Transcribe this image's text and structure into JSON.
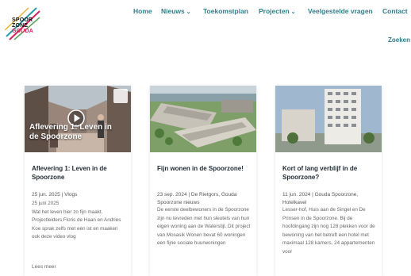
{
  "logo": {
    "line1": "SPOOR",
    "line2": "ZONE",
    "line3": "GOUDA"
  },
  "nav": {
    "items": [
      {
        "label": "Home",
        "dropdown": false
      },
      {
        "label": "Nieuws",
        "dropdown": true
      },
      {
        "label": "Toekomstplan",
        "dropdown": false
      },
      {
        "label": "Projecten",
        "dropdown": true
      },
      {
        "label": "Veelgestelde vragen",
        "dropdown": false
      },
      {
        "label": "Contact",
        "dropdown": false
      }
    ],
    "search_label": "Zoeken",
    "chevron": "⌄"
  },
  "cards": [
    {
      "video_caption": "Aflevering 1: Leven in de Spoorzone",
      "title": "Aflevering 1: Leven in de Spoorzone",
      "meta": "25 jun. 2025 | Vlogs",
      "date_line": "25 juni 2025",
      "excerpt": "Wat het leven hier zo fijn maakt. Projectleiders Floris de Haan en Andries Koe sprak zelfs met een ist en maaken ook deze video vlog",
      "read_more": "Lees meer"
    },
    {
      "title": "Fijn wonen in de Spoorzone!",
      "meta": "23 sep. 2024 | De Rietgors, Gouda Spoorzone nieuws",
      "excerpt": "De eerste deelbewoners in de Spoorzone zijn nu tevreden met hun sleutels van hun eigen woning aan de Waterstijl. Dit project van Mosasik Wonen bevat 60 woningen een fijne sociale huurwoningen",
      "read_more": ""
    },
    {
      "title": "Kort of lang verblijf in de Spoorzone?",
      "meta": "11 jun. 2024 | Gouda Spoorzone, Hotelkavel",
      "excerpt": "Lesser-hof, Huis aan de Singel en De Prinsen in de Spoorzone. Bij de hoofdingang zijn nog 128 plekken voor de bewoning van het betreft een hotel met maximaal 128 kamers, 24 appartementen voor",
      "read_more": ""
    }
  ],
  "colors": {
    "nav": "#2f7e8a",
    "logo_accent": "#d1245a"
  }
}
